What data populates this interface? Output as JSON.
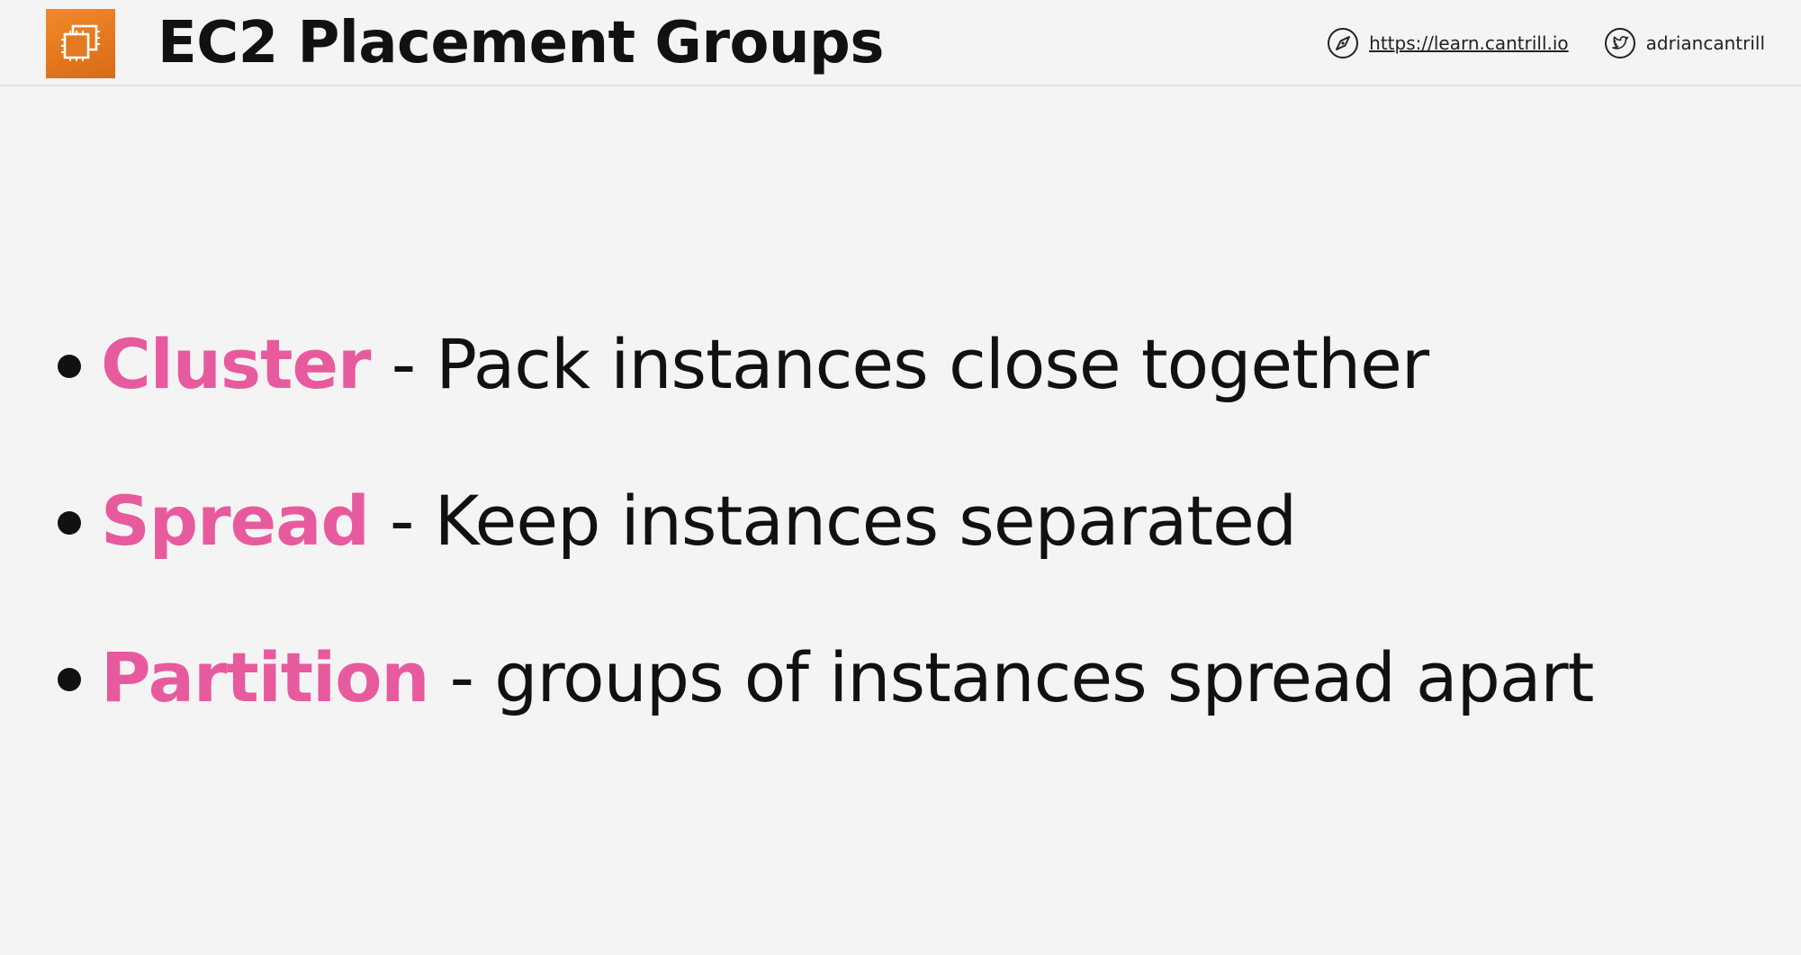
{
  "header": {
    "title": "EC2 Placement Groups",
    "website_icon": "compass-icon",
    "website_url": "https://learn.cantrill.io",
    "twitter_icon": "twitter-bird-icon",
    "twitter_handle": "adriancantrill",
    "logo_icon": "ec2-chip-icon",
    "logo_color": "#e8761f"
  },
  "bullets": [
    {
      "term": "Cluster",
      "separator": " - ",
      "description": "Pack instances close together"
    },
    {
      "term": "Spread",
      "separator": " - ",
      "description": "Keep instances separated"
    },
    {
      "term": "Partition",
      "separator": " - ",
      "description": "groups of instances spread apart"
    }
  ],
  "colors": {
    "accent": "#e85a9e",
    "text": "#111111",
    "background": "#f4f4f4"
  }
}
